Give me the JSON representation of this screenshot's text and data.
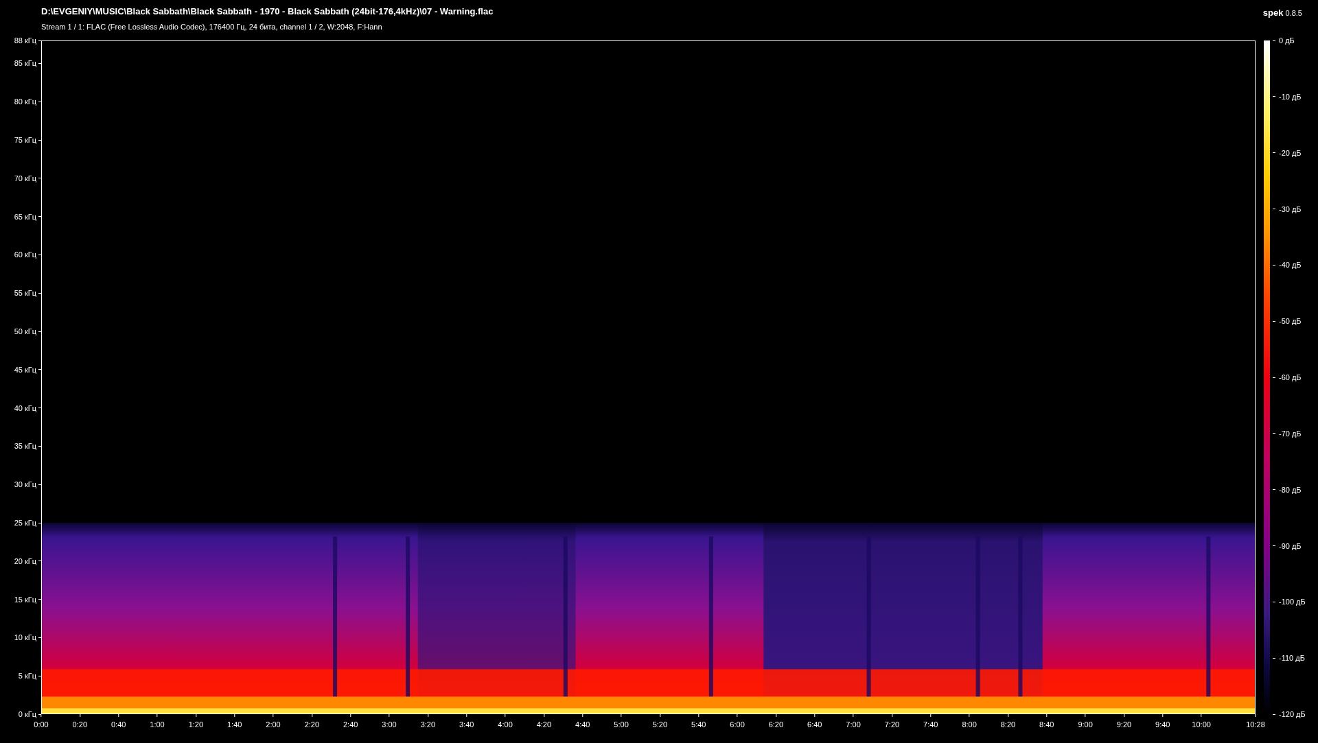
{
  "header": {
    "file_path": "D:\\EVGENIY\\MUSIC\\Black Sabbath\\Black Sabbath - 1970 - Black Sabbath (24bit-176,4kHz)\\07 - Warning.flac",
    "stream_info": "Stream 1 / 1: FLAC (Free Lossless Audio Codec), 176400 Гц, 24 бита, channel 1 / 2, W:2048, F:Hann",
    "app_name": "**spek** 0.8.5"
  },
  "frequency_axis": [
    "88 кГц",
    "85 кГц",
    "80 кГц",
    "75 кГц",
    "70 кГц",
    "65 кГц",
    "60 кГц",
    "55 кГц",
    "50 кГц",
    "45 кГц",
    "40 кГц",
    "35 кГц",
    "30 кГц",
    "25 кГц",
    "20 кГц",
    "15 кГц",
    "10 кГц",
    "5 кГц",
    "0 кГц"
  ],
  "time_axis": [
    "0:00",
    "0:20",
    "0:40",
    "1:00",
    "1:20",
    "1:40",
    "2:00",
    "2:20",
    "2:40",
    "3:00",
    "3:20",
    "3:40",
    "4:00",
    "4:20",
    "4:40",
    "5:00",
    "5:20",
    "5:40",
    "6:00",
    "6:20",
    "6:40",
    "7:00",
    "7:20",
    "7:40",
    "8:00",
    "8:20",
    "8:40",
    "9:00",
    "9:20",
    "9:40",
    "10:00",
    "10:28"
  ],
  "decibel_scale": [
    "0 дБ",
    "-10 дБ",
    "-20 дБ",
    "-30 дБ",
    "-40 дБ",
    "-50 дБ",
    "-60 дБ",
    "-70 дБ",
    "-80 дБ",
    "-90 дБ",
    "-100 дБ",
    "-110 дБ",
    "-120 дБ"
  ]
}
